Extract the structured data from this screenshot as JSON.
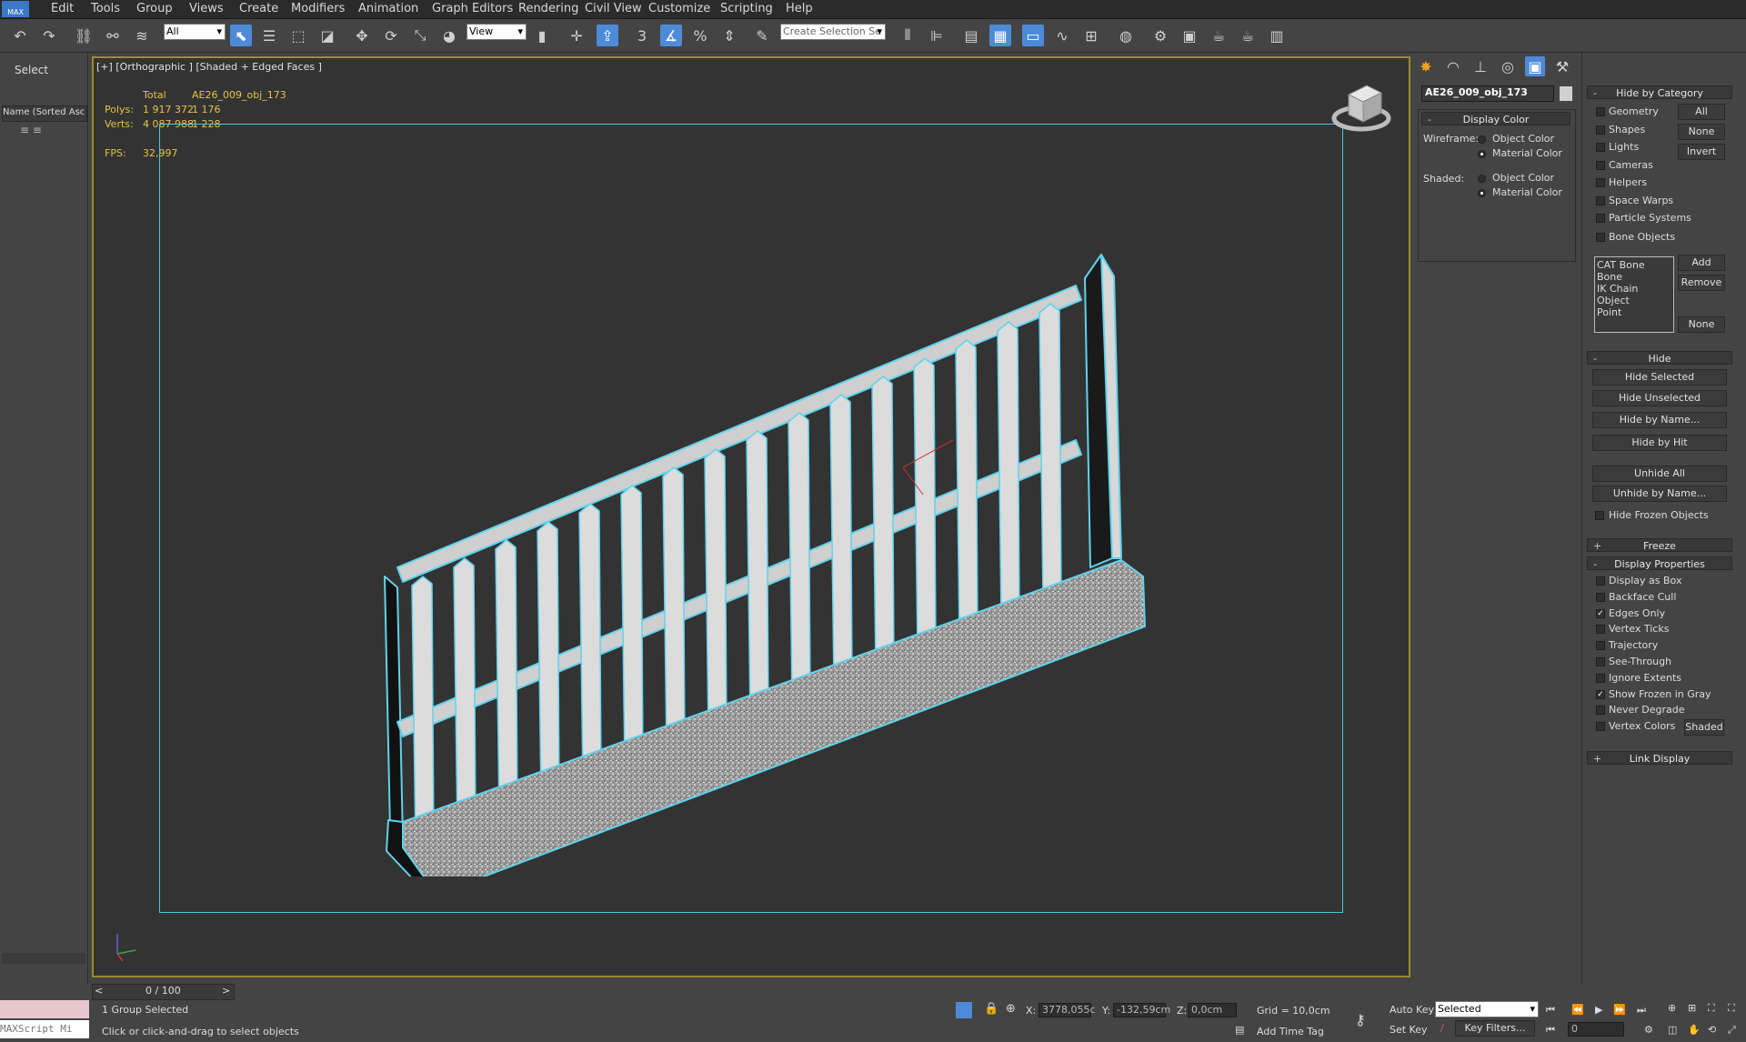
{
  "menubar": {
    "items": [
      "Edit",
      "Tools",
      "Group",
      "Views",
      "Create",
      "Modifiers",
      "Animation",
      "Graph Editors",
      "Rendering",
      "Civil View",
      "Customize",
      "Scripting",
      "Help"
    ],
    "logo": "MAX"
  },
  "toolbar": {
    "filter_value": "All",
    "refcoord_value": "View",
    "selection_set_placeholder": "Create Selection Se",
    "snap_label": "3",
    "percent_label": "%"
  },
  "left_panel": {
    "select_label": "Select",
    "sort_header": "Name (Sorted Asc"
  },
  "viewport": {
    "label": "[+] [Orthographic ] [Shaded + Edged Faces ]",
    "stats": {
      "total_label": "Total",
      "object_name": "AE26_009_obj_173",
      "polys_label": "Polys:",
      "polys_total": "1 917 372",
      "polys_obj": "1 176",
      "verts_label": "Verts:",
      "verts_total": "4 087 988",
      "verts_obj": "1 228",
      "fps_label": "FPS:",
      "fps_value": "32,997"
    }
  },
  "command_panel": {
    "object_name": "AE26_009_obj_173",
    "display_color": {
      "header": "Display Color",
      "wireframe_label": "Wireframe:",
      "shaded_label": "Shaded:",
      "object_color": "Object Color",
      "material_color": "Material Color"
    },
    "hide_by_category": {
      "header": "Hide by Category",
      "items": [
        "Geometry",
        "Shapes",
        "Lights",
        "Cameras",
        "Helpers",
        "Space Warps",
        "Particle Systems",
        "Bone Objects"
      ],
      "buttons": [
        "All",
        "None",
        "Invert"
      ],
      "list": [
        "CAT Bone",
        "Bone",
        "IK Chain Object",
        "Point"
      ],
      "list_buttons": [
        "Add",
        "Remove",
        "None"
      ]
    },
    "hide": {
      "header": "Hide",
      "buttons": [
        "Hide Selected",
        "Hide Unselected",
        "Hide by Name...",
        "Hide by Hit",
        "Unhide All",
        "Unhide by Name..."
      ],
      "hide_frozen": "Hide Frozen Objects"
    },
    "freeze": {
      "header": "Freeze"
    },
    "display_properties": {
      "header": "Display Properties",
      "items": [
        {
          "label": "Display as Box",
          "checked": false
        },
        {
          "label": "Backface Cull",
          "checked": false
        },
        {
          "label": "Edges Only",
          "checked": true
        },
        {
          "label": "Vertex Ticks",
          "checked": false
        },
        {
          "label": "Trajectory",
          "checked": false
        },
        {
          "label": "See-Through",
          "checked": false
        },
        {
          "label": "Ignore Extents",
          "checked": false
        },
        {
          "label": "Show Frozen in Gray",
          "checked": true
        },
        {
          "label": "Never Degrade",
          "checked": false
        },
        {
          "label": "Vertex Colors",
          "checked": false
        }
      ],
      "shaded_button": "Shaded"
    },
    "link_display": {
      "header": "Link Display"
    }
  },
  "timeline": {
    "frame": "0 / 100",
    "prev": "<",
    "next": ">"
  },
  "status": {
    "selection": "1 Group Selected",
    "prompt": "Click or click-and-drag to select objects",
    "maxscript": "MAXScript Mi",
    "x_label": "X:",
    "x_value": "3778,055c",
    "y_label": "Y:",
    "y_value": "-132,59cm",
    "z_label": "Z:",
    "z_value": "0,0cm",
    "grid": "Grid = 10,0cm",
    "add_time_tag": "Add Time Tag",
    "auto_key": "Auto Key",
    "set_key": "Set Key",
    "key_mode": "Selected",
    "key_filters": "Key Filters...",
    "frame_field": "0"
  },
  "colors": {
    "viewport_border": "#9c8a2c",
    "selection": "#5fd3ec",
    "accent": "#4d8bd9"
  }
}
